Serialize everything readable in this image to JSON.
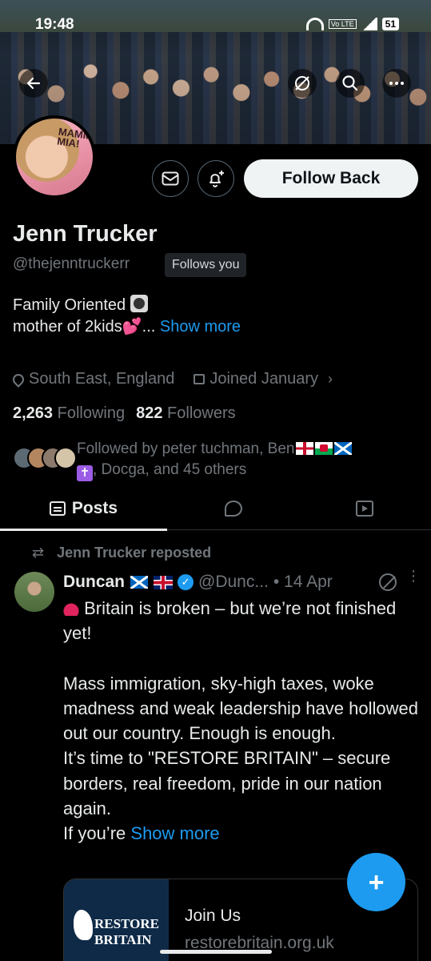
{
  "status_bar": {
    "time": "19:48",
    "network": "Vo LTE",
    "battery": "51"
  },
  "profile": {
    "name": "Jenn Trucker",
    "handle": "@thejenntruckerr",
    "follows_you": "Follows you",
    "follow_back_label": "Follow Back",
    "bio_line1": "Family Oriented",
    "bio_line2": "mother of 2kids",
    "bio_ellipsis": "...",
    "bio_show_more": "Show more",
    "location": "South East, England",
    "joined": "Joined January",
    "following_count": "2,263",
    "following_label": "Following",
    "followers_count": "822",
    "followers_label": "Followers",
    "followed_by_prefix": "Followed by peter tuchman, Ben",
    "followed_by_suffix": ", Docga, and 45 others",
    "avatar_text": "MAMMA MIA!"
  },
  "tabs": {
    "posts": "Posts"
  },
  "post": {
    "repost_label": "Jenn Trucker reposted",
    "author": "Duncan",
    "handle": "@Dunc...",
    "date": "• 14 Apr",
    "verified_glyph": "✓",
    "line1": "Britain is broken – but we’re not finished yet!",
    "para2": "Mass immigration, sky-high taxes, woke madness and weak leadership have hollowed out our country. Enough is enough.",
    "para3": "It’s time to \"RESTORE BRITAIN\" – secure borders, real freedom, pride in our nation again.",
    "para4_prefix": "If you’re",
    "show_more": "Show more",
    "card_brand_line1": "RESTORE",
    "card_brand_line2": "BRITAIN",
    "card_title": "Join Us",
    "card_url": "restorebritain.org.uk"
  },
  "colors": {
    "accent": "#1d9bf0",
    "background": "#000000",
    "muted": "#71767b",
    "text": "#e7e9ea"
  },
  "icons": [
    "back-arrow-icon",
    "grok-icon",
    "search-icon",
    "more-icon",
    "envelope-icon",
    "bell-plus-icon",
    "location-pin-icon",
    "calendar-icon",
    "chevron-right-icon",
    "posts-tab-icon",
    "replies-bubble-icon",
    "media-icon",
    "repost-icon",
    "verified-icon",
    "plus-icon"
  ]
}
